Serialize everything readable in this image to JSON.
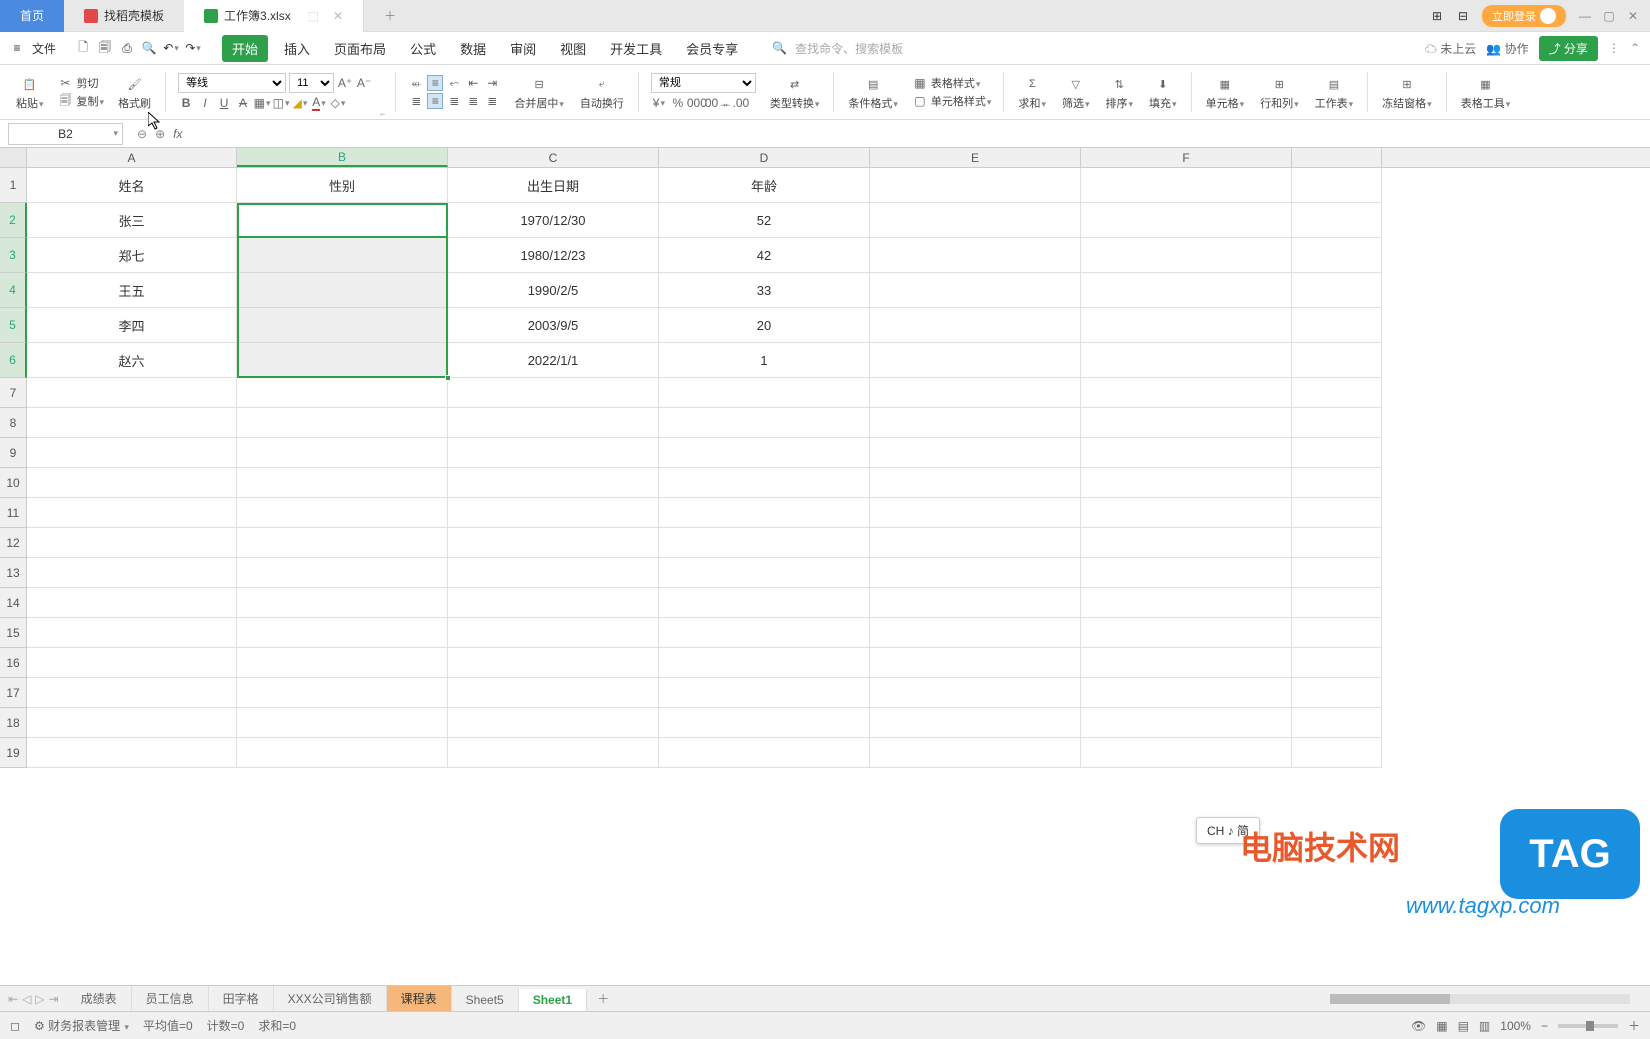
{
  "tabs": {
    "home": "首页",
    "template": "找稻壳模板",
    "file": "工作簿3.xlsx"
  },
  "topRight": {
    "login": "立即登录"
  },
  "menuBar": {
    "file": "文件",
    "items": [
      "开始",
      "插入",
      "页面布局",
      "公式",
      "数据",
      "审阅",
      "视图",
      "开发工具",
      "会员专享"
    ],
    "searchHint": "查找命令、搜索模板",
    "cloud": "未上云",
    "collab": "协作",
    "share": "分享"
  },
  "ribbon": {
    "paste": "粘贴",
    "cut": "剪切",
    "copy": "复制",
    "formatPainter": "格式刷",
    "font": "等线",
    "fontSize": "11",
    "mergeCenter": "合并居中",
    "autoWrap": "自动换行",
    "numberFormat": "常规",
    "typeConvert": "类型转换",
    "condFormat": "条件格式",
    "tableStyle": "表格样式",
    "cellStyle": "单元格样式",
    "sum": "求和",
    "filter": "筛选",
    "sort": "排序",
    "fill": "填充",
    "cell": "单元格",
    "rowCol": "行和列",
    "worksheet": "工作表",
    "freeze": "冻结窗格",
    "tableTools": "表格工具"
  },
  "nameBox": "B2",
  "columns": [
    "A",
    "B",
    "C",
    "D",
    "E",
    "F"
  ],
  "rows": [
    "1",
    "2",
    "3",
    "4",
    "5",
    "6",
    "7",
    "8",
    "9",
    "10",
    "11",
    "12",
    "13",
    "14",
    "15",
    "16",
    "17",
    "18",
    "19"
  ],
  "headers": {
    "A": "姓名",
    "B": "性别",
    "C": "出生日期",
    "D": "年龄"
  },
  "data": [
    {
      "A": "张三",
      "C": "1970/12/30",
      "D": "52"
    },
    {
      "A": "郑七",
      "C": "1980/12/23",
      "D": "42"
    },
    {
      "A": "王五",
      "C": "1990/2/5",
      "D": "33"
    },
    {
      "A": "李四",
      "C": "2003/9/5",
      "D": "20"
    },
    {
      "A": "赵六",
      "C": "2022/1/1",
      "D": "1"
    }
  ],
  "sheets": {
    "list": [
      "成绩表",
      "员工信息",
      "田字格",
      "XXX公司销售额",
      "课程表",
      "Sheet5",
      "Sheet1"
    ],
    "active": "Sheet1",
    "highlighted": "课程表"
  },
  "statusBar": {
    "mgr": "财务报表管理",
    "avg": "平均值=0",
    "count": "计数=0",
    "sum": "求和=0",
    "zoom": "100%"
  },
  "ime": "CH ♪ 简",
  "watermark": {
    "text1": "电脑技术网",
    "url": "www.tagxp.com",
    "tag": "TAG"
  }
}
